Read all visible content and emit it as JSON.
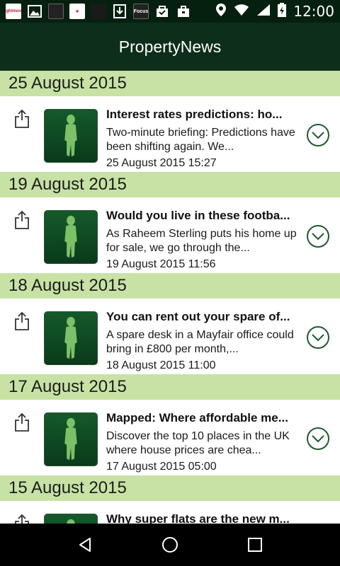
{
  "status_bar": {
    "time": "12:00",
    "notifications": [
      "rightmove-notification-icon",
      "gallery-notification-icon",
      "news-notification-icon",
      "rightmove-red-notification-icon",
      "gold-notification-icon",
      "download-notification-icon",
      "focus-notification-icon",
      "shopping-notification-icon",
      "briefcase-notification-icon"
    ],
    "notification_labels": {
      "rightmove": "rightmove",
      "focus": "Focus"
    }
  },
  "app_bar": {
    "title": "PropertyNews"
  },
  "sections": [
    {
      "date": "25 August 2015",
      "title": "Interest rates predictions: ho...",
      "summary": "Two-minute briefing: Predictions have been shifting again. We...",
      "timestamp": "25 August 2015 15:27"
    },
    {
      "date": "19 August 2015",
      "title": "Would you live in these footba...",
      "summary": "As Raheem Sterling puts his home up for sale, we go through the...",
      "timestamp": "19 August 2015 11:56"
    },
    {
      "date": "18 August 2015",
      "title": "You can rent out your spare of...",
      "summary": "A spare desk in a Mayfair office could bring in £800 per month,...",
      "timestamp": "18 August 2015 11:00"
    },
    {
      "date": "17 August 2015",
      "title": "Mapped: Where affordable me...",
      "summary": "Discover the top 10 places in the UK where house prices are chea...",
      "timestamp": "17 August 2015 05:00"
    },
    {
      "date": "15 August 2015",
      "title": "Why super flats are the new m...",
      "summary": "",
      "timestamp": ""
    }
  ],
  "colors": {
    "status_bar": "#06200f",
    "app_bar": "#0c2e1a",
    "date_header": "#c7e2a4",
    "accent": "#1e5a2e"
  }
}
